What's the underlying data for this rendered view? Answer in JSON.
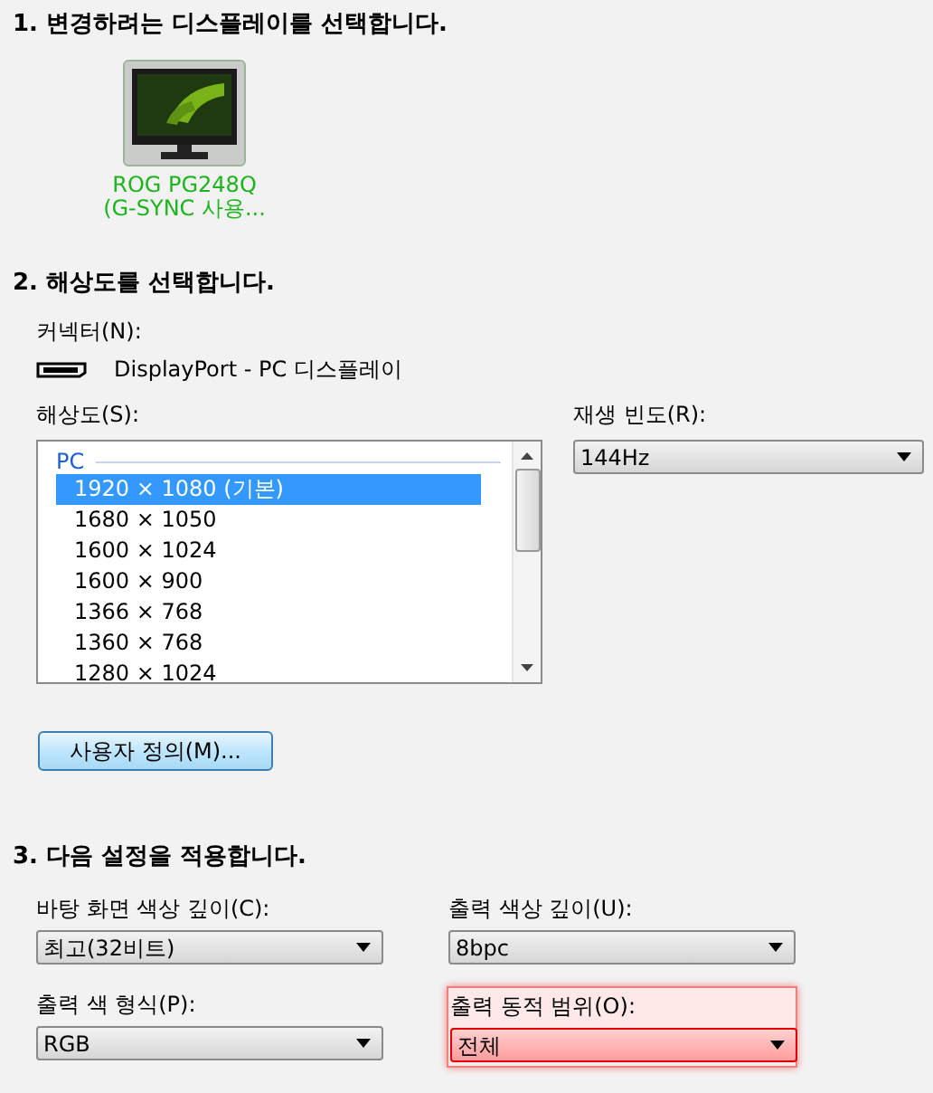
{
  "step1": {
    "heading": "1. 변경하려는 디스플레이를 선택합니다.",
    "displays": [
      {
        "name_lines": [
          "ROG PG248Q",
          "(G-SYNC 사용..."
        ],
        "selected": true
      }
    ]
  },
  "step2": {
    "heading": "2. 해상도를 선택합니다.",
    "connector_label": "커넥터(N):",
    "connector": "DisplayPort - PC 디스플레이",
    "resolution_label": "해상도(S):",
    "resolution_group": "PC",
    "resolutions": [
      {
        "text": "1920 × 1080 (기본)",
        "selected": true
      },
      {
        "text": "1680 × 1050",
        "selected": false
      },
      {
        "text": "1600 × 1024",
        "selected": false
      },
      {
        "text": "1600 × 900",
        "selected": false
      },
      {
        "text": "1366 × 768",
        "selected": false
      },
      {
        "text": "1360 × 768",
        "selected": false
      },
      {
        "text": "1280 × 1024",
        "selected": false
      }
    ],
    "refresh_label": "재생 빈도(R):",
    "refresh_value": "144Hz",
    "custom_button": "사용자 정의(M)..."
  },
  "step3": {
    "heading": "3. 다음 설정을 적용합니다.",
    "fields": [
      {
        "label": "바탕 화면 색상 깊이(C):",
        "value": "최고(32비트)",
        "highlighted": false
      },
      {
        "label": "출력 색상 깊이(U):",
        "value": "8bpc",
        "highlighted": false
      },
      {
        "label": "출력 색 형식(P):",
        "value": "RGB",
        "highlighted": false
      },
      {
        "label": "출력 동적 범위(O):",
        "value": "전체",
        "highlighted": true
      }
    ]
  }
}
